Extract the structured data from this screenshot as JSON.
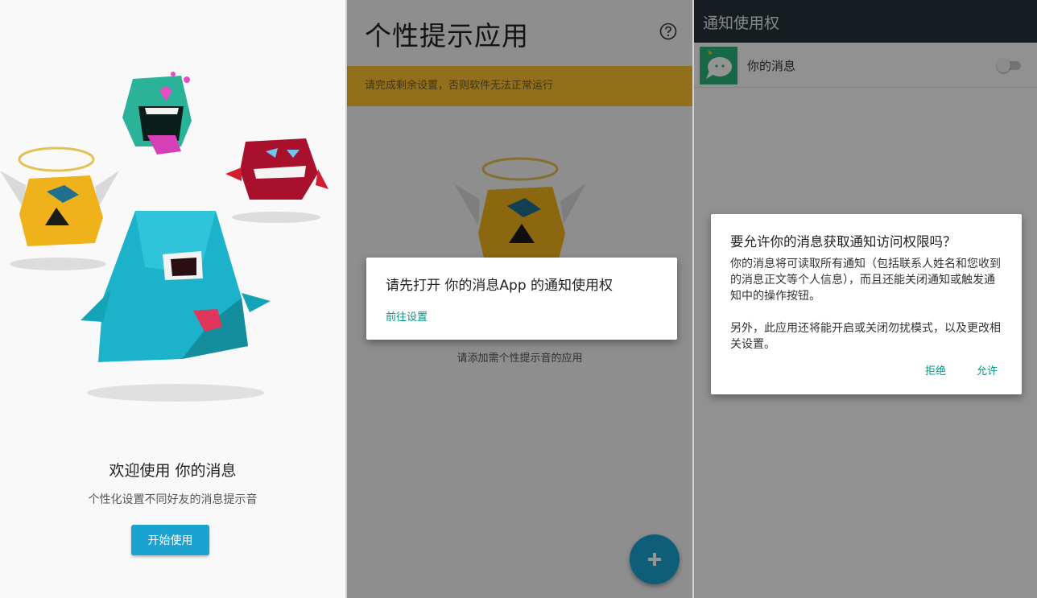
{
  "welcome": {
    "title": "欢迎使用 你的消息",
    "subtitle": "个性化设置不同好友的消息提示音",
    "start_button": "开始使用"
  },
  "app_screen": {
    "title": "个性提示应用",
    "help_icon": "help-circle-icon",
    "warning_banner": "请完成剩余设置，否则软件无法正常运行",
    "empty_hint": "请添加需个性提示音的应用",
    "fab_icon": "plus-icon",
    "dialog": {
      "title": "请先打开 你的消息App 的通知使用权",
      "link": "前往设置"
    }
  },
  "settings_screen": {
    "title": "通知使用权",
    "app_row": {
      "label": "你的消息",
      "toggle_on": false
    },
    "dialog": {
      "title": "要允许你的消息获取通知访问权限吗？",
      "body_1": "你的消息将可读取所有通知（包括联系人姓名和您收到的消息正文等个人信息），而且还能关闭通知或触发通知中的操作按钮。",
      "body_2": "另外，此应用还将能开启或关闭勿扰模式，以及更改相关设置。",
      "deny": "拒绝",
      "allow": "允许"
    }
  },
  "colors": {
    "accent": "#1aa3d1",
    "warning": "#fbc02d",
    "dialog_link": "#009688",
    "status_bar": "#263238"
  }
}
